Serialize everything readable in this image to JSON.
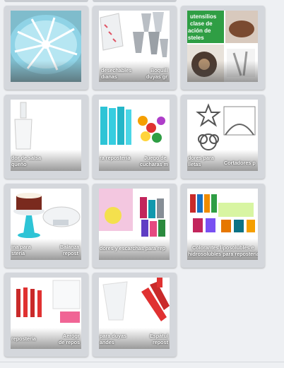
{
  "tiles": [
    {
      "id": "blue-cake",
      "captions": []
    },
    {
      "id": "piping-tips",
      "captions": [
        "desechables",
        "dianas",
        "Boquill",
        "duyas gr"
      ]
    },
    {
      "id": "utensils-class",
      "overlay": [
        "utensilios",
        "clase de",
        "ación de",
        "steles"
      ],
      "captions": []
    },
    {
      "id": "sauce-dispenser",
      "captions": [
        "dor de salsa",
        "queño"
      ]
    },
    {
      "id": "spatulas-spoons",
      "captions": [
        "ra repostería",
        "Juego de",
        "cucharas m"
      ]
    },
    {
      "id": "cutters",
      "captions": [
        "dores para",
        "lletas",
        "Cortadores p"
      ]
    },
    {
      "id": "turntable-scale",
      "captions": [
        "ina para",
        "stería",
        "Balanza",
        "repost"
      ]
    },
    {
      "id": "glitter",
      "captions": [
        "dores y escarchas para rep"
      ]
    },
    {
      "id": "colorants",
      "captions": [
        "Colorantes liposolubles e",
        "hidrosolubles para repostería"
      ]
    },
    {
      "id": "red-tools",
      "captions": [
        "repostería",
        "Aerógr",
        "de repos"
      ]
    },
    {
      "id": "piping-bags",
      "captions": [
        "para duyas",
        "andes",
        "Espátul",
        "repost"
      ]
    }
  ]
}
